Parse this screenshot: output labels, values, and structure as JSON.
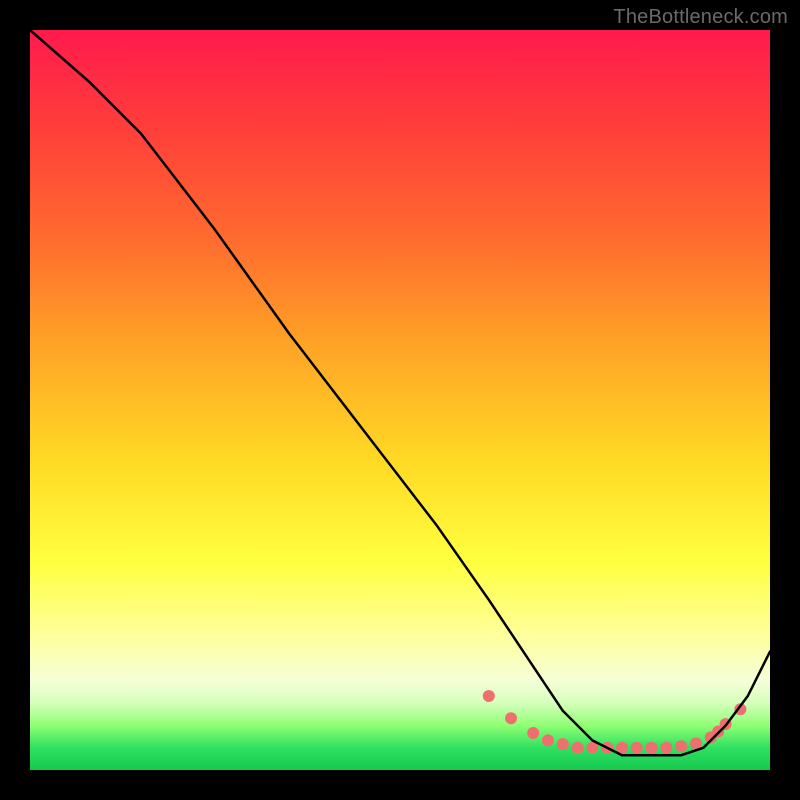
{
  "watermark": "TheBottleneck.com",
  "chart_data": {
    "type": "line",
    "title": "",
    "xlabel": "",
    "ylabel": "",
    "xlim": [
      0,
      100
    ],
    "ylim": [
      0,
      100
    ],
    "grid": false,
    "series": [
      {
        "name": "curve",
        "color": "#000000",
        "x": [
          0,
          8,
          15,
          25,
          35,
          45,
          55,
          62,
          68,
          72,
          76,
          80,
          84,
          88,
          91,
          94,
          97,
          100
        ],
        "values": [
          100,
          93,
          86,
          73,
          59,
          46,
          33,
          23,
          14,
          8,
          4,
          2,
          2,
          2,
          3,
          6,
          10,
          16
        ]
      }
    ],
    "markers": {
      "name": "dots",
      "color": "#ef6f6f",
      "radius": 6,
      "x": [
        62,
        65,
        68,
        70,
        72,
        74,
        76,
        78,
        80,
        82,
        84,
        86,
        88,
        90,
        92,
        93,
        94,
        96
      ],
      "values": [
        10,
        7,
        5,
        4,
        3.5,
        3,
        3,
        3,
        3,
        3,
        3,
        3,
        3.2,
        3.6,
        4.4,
        5.2,
        6.2,
        8.2
      ]
    }
  }
}
